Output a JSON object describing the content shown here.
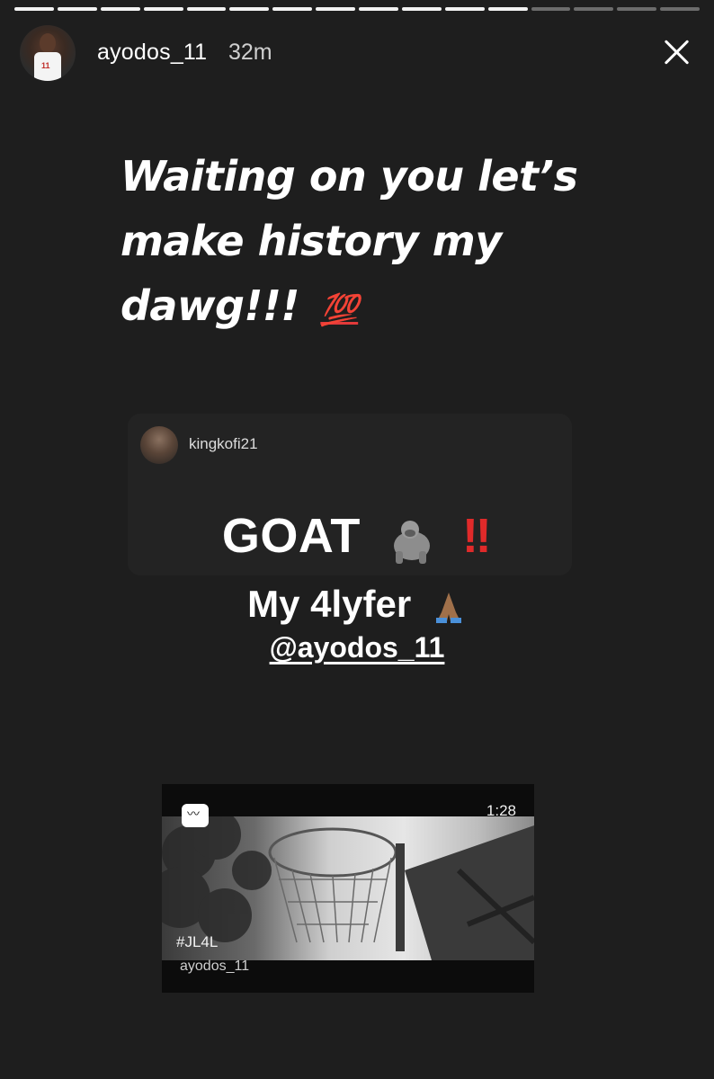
{
  "story": {
    "progress_total": 16,
    "progress_done": 12,
    "header": {
      "username": "ayodos_11",
      "time_ago": "32m",
      "close_icon": "close-icon"
    },
    "caption": {
      "text": "Waiting on you let’s make history my dawg!!!",
      "emoji": "💯"
    }
  },
  "shared_post": {
    "username": "kingkofi21",
    "line1_text": "GOAT",
    "line1_icon": "gorilla-icon",
    "line1_emoji_bang": "‼",
    "line2_text": "My 4lyfer",
    "line2_icon": "folded-hands-icon",
    "mention": "@ayodos_11"
  },
  "video": {
    "icon": "igtv-icon",
    "duration": "1:28",
    "hashtag": "#JL4L",
    "username": "ayodos_11"
  }
}
